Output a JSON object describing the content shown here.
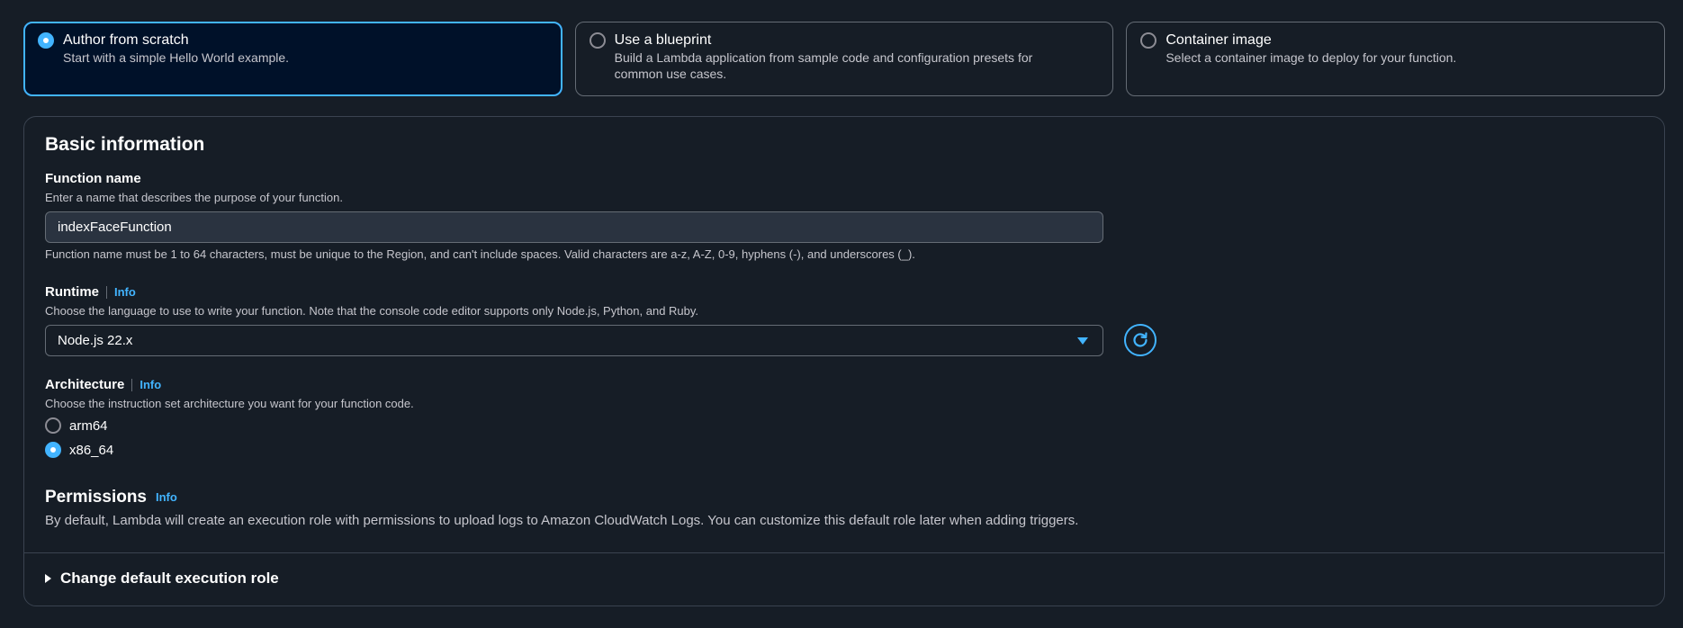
{
  "options": [
    {
      "title": "Author from scratch",
      "desc": "Start with a simple Hello World example.",
      "selected": true
    },
    {
      "title": "Use a blueprint",
      "desc": "Build a Lambda application from sample code and configuration presets for common use cases.",
      "selected": false
    },
    {
      "title": "Container image",
      "desc": "Select a container image to deploy for your function.",
      "selected": false
    }
  ],
  "basic": {
    "title": "Basic information",
    "function_name": {
      "label": "Function name",
      "desc": "Enter a name that describes the purpose of your function.",
      "value": "indexFaceFunction",
      "constraint": "Function name must be 1 to 64 characters, must be unique to the Region, and can't include spaces. Valid characters are a-z, A-Z, 0-9, hyphens (-), and underscores (_)."
    },
    "runtime": {
      "label": "Runtime",
      "info": "Info",
      "desc": "Choose the language to use to write your function. Note that the console code editor supports only Node.js, Python, and Ruby.",
      "value": "Node.js 22.x"
    },
    "architecture": {
      "label": "Architecture",
      "info": "Info",
      "desc": "Choose the instruction set architecture you want for your function code.",
      "options": [
        {
          "label": "arm64",
          "selected": false
        },
        {
          "label": "x86_64",
          "selected": true
        }
      ]
    },
    "permissions": {
      "title": "Permissions",
      "info": "Info",
      "desc": "By default, Lambda will create an execution role with permissions to upload logs to Amazon CloudWatch Logs. You can customize this default role later when adding triggers."
    },
    "expander_label": "Change default execution role"
  },
  "colors": {
    "accent": "#42b4ff",
    "background": "#161d26",
    "selected_card": "#001129"
  }
}
